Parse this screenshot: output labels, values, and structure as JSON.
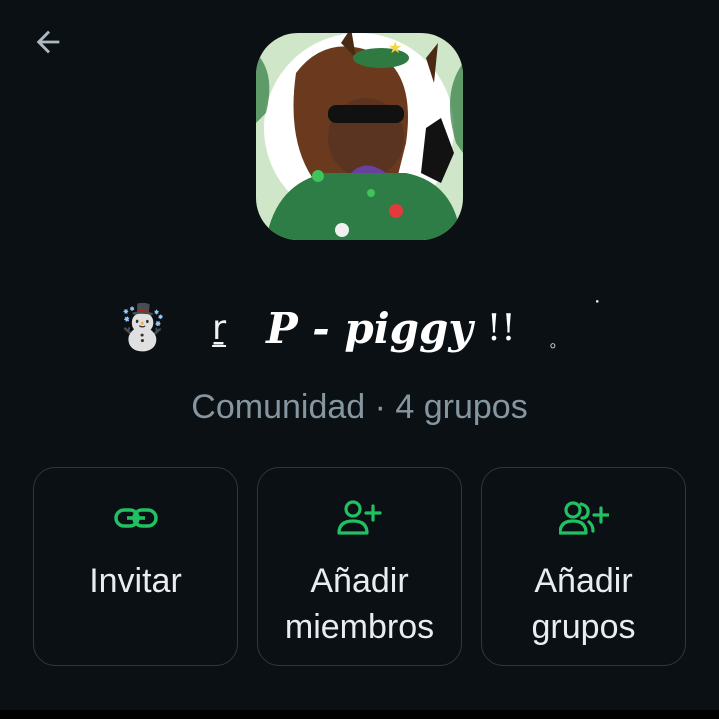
{
  "header": {
    "back_icon": "arrow-left-icon"
  },
  "community": {
    "name_emoji": "☃️",
    "name_glyph": "ṟ",
    "name_main": "P - piggy",
    "name_bangs": "!!",
    "name_small_circle": "。",
    "name_dot": "˙",
    "subtitle": "Comunidad · 4 grupos"
  },
  "actions": [
    {
      "icon": "link-icon",
      "label": "Invitar"
    },
    {
      "icon": "add-person-icon",
      "label": "Añadir\nmiembros"
    },
    {
      "icon": "add-group-icon",
      "label": "Añadir\ngrupos"
    }
  ],
  "colors": {
    "background": "#0b1014",
    "accent": "#21c063",
    "text_primary": "#e9edef",
    "text_secondary": "#8696a0",
    "card_border": "#2d383e"
  }
}
